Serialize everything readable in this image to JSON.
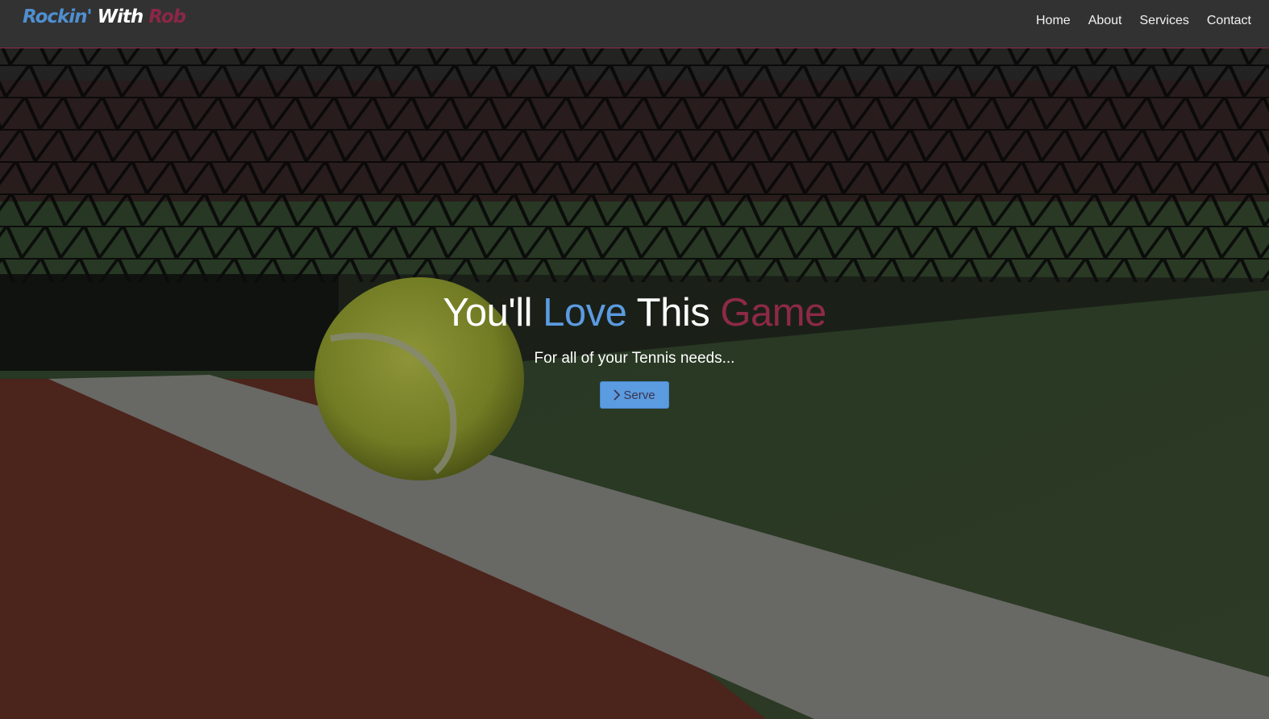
{
  "brand": {
    "part1": "Rockin'",
    "part2": " With ",
    "part3": "Rob"
  },
  "nav": {
    "items": [
      {
        "label": "Home"
      },
      {
        "label": "About"
      },
      {
        "label": "Services"
      },
      {
        "label": "Contact"
      }
    ]
  },
  "hero": {
    "title_1": "You'll ",
    "title_2": "Love",
    "title_3": " This ",
    "title_4": "Game",
    "subtitle": "For all of your Tennis needs...",
    "button_label": "Serve",
    "button_icon": "chevron-right-icon"
  },
  "colors": {
    "accent_blue": "#5b9be0",
    "accent_red": "#8e2947",
    "navbar_bg": "#343434"
  }
}
